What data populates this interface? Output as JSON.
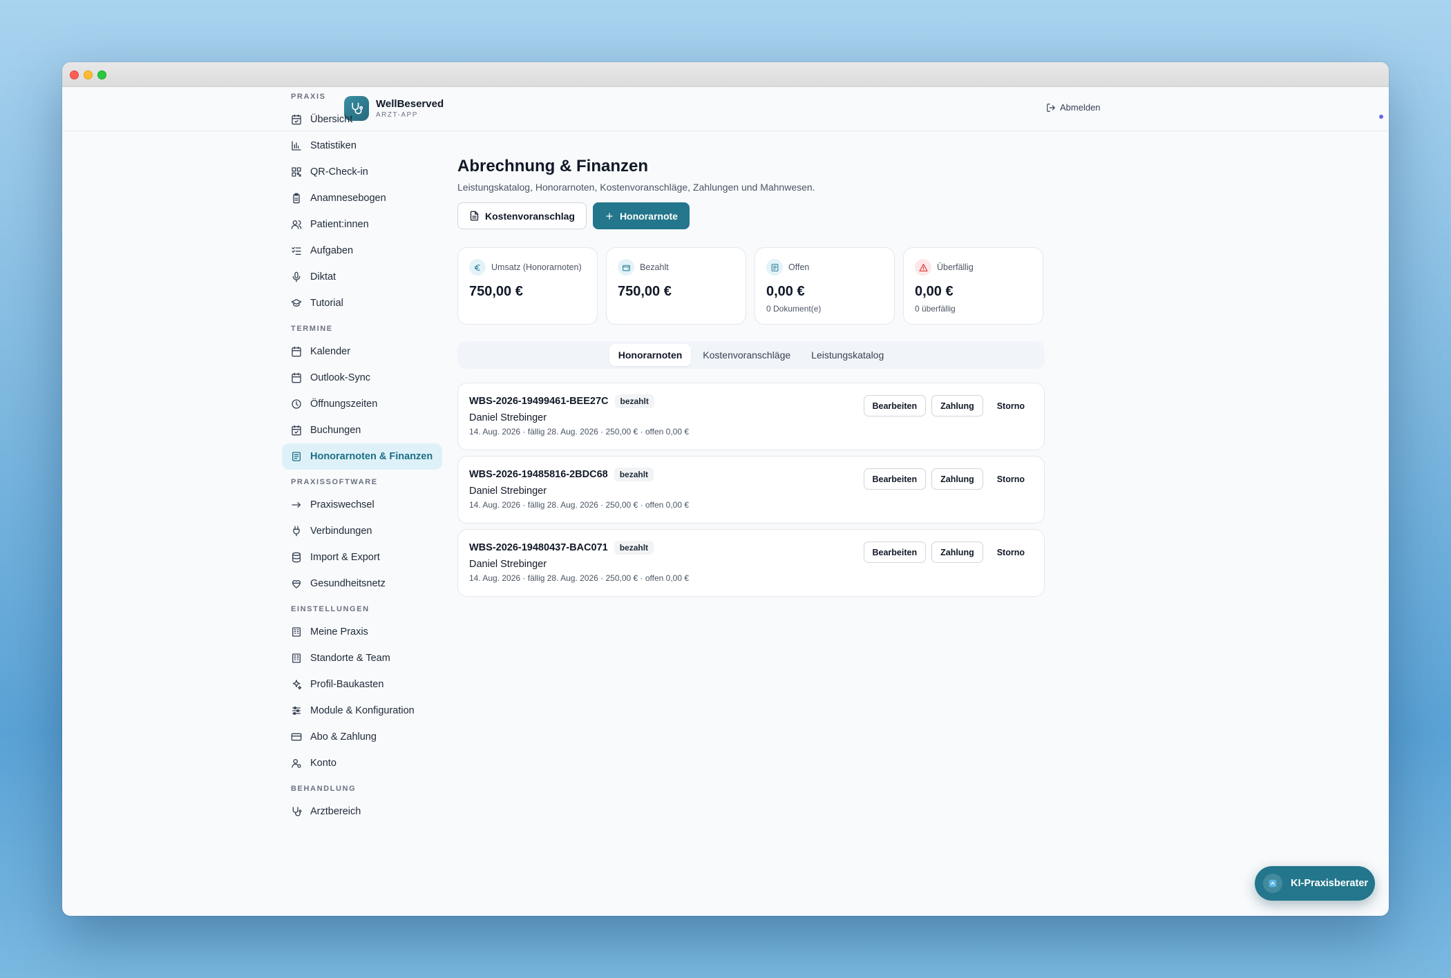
{
  "brand": {
    "name": "WellBeserved",
    "sub": "ARZT-APP"
  },
  "header": {
    "logout_label": "Abmelden"
  },
  "sidebar": {
    "sections": [
      {
        "label": "PRAXIS",
        "items": [
          {
            "label": "Übersicht",
            "icon": "calendar-check-icon"
          },
          {
            "label": "Statistiken",
            "icon": "bar-chart-icon"
          },
          {
            "label": "QR-Check-in",
            "icon": "qr-code-icon"
          },
          {
            "label": "Anamnesebogen",
            "icon": "clipboard-icon"
          },
          {
            "label": "Patient:innen",
            "icon": "users-icon"
          },
          {
            "label": "Aufgaben",
            "icon": "checklist-icon"
          },
          {
            "label": "Diktat",
            "icon": "microphone-icon"
          },
          {
            "label": "Tutorial",
            "icon": "graduation-cap-icon"
          }
        ]
      },
      {
        "label": "TERMINE",
        "items": [
          {
            "label": "Kalender",
            "icon": "calendar-icon"
          },
          {
            "label": "Outlook-Sync",
            "icon": "calendar-icon"
          },
          {
            "label": "Öffnungszeiten",
            "icon": "clock-icon"
          },
          {
            "label": "Buchungen",
            "icon": "calendar-check-icon"
          },
          {
            "label": "Honorarnoten & Finanzen",
            "icon": "receipt-icon",
            "active": true
          }
        ]
      },
      {
        "label": "PRAXISSOFTWARE",
        "items": [
          {
            "label": "Praxiswechsel",
            "icon": "arrow-right-icon"
          },
          {
            "label": "Verbindungen",
            "icon": "plug-icon"
          },
          {
            "label": "Import & Export",
            "icon": "database-icon"
          },
          {
            "label": "Gesundheitsnetz",
            "icon": "heart-network-icon"
          }
        ]
      },
      {
        "label": "EINSTELLUNGEN",
        "items": [
          {
            "label": "Meine Praxis",
            "icon": "building-icon"
          },
          {
            "label": "Standorte & Team",
            "icon": "building-icon"
          },
          {
            "label": "Profil-Baukasten",
            "icon": "sparkles-icon"
          },
          {
            "label": "Module & Konfiguration",
            "icon": "sliders-icon"
          },
          {
            "label": "Abo & Zahlung",
            "icon": "credit-card-icon"
          },
          {
            "label": "Konto",
            "icon": "user-gear-icon"
          }
        ]
      },
      {
        "label": "BEHANDLUNG",
        "items": [
          {
            "label": "Arztbereich",
            "icon": "stethoscope-icon"
          }
        ]
      }
    ]
  },
  "page": {
    "title": "Abrechnung & Finanzen",
    "subtitle": "Leistungskatalog, Honorarnoten, Kostenvoranschläge, Zahlungen und Mahnwesen.",
    "btn_quote": "Kostenvoranschlag",
    "btn_invoice": "Honorarnote"
  },
  "stats": [
    {
      "label": "Umsatz (Honorarnoten)",
      "value": "750,00 €",
      "note": "",
      "icon": "euro-icon",
      "color": "#2b7f95",
      "bg": "#e4f3f8"
    },
    {
      "label": "Bezahlt",
      "value": "750,00 €",
      "note": "",
      "icon": "wallet-icon",
      "color": "#2b7f95",
      "bg": "#e4f3f8"
    },
    {
      "label": "Offen",
      "value": "0,00 €",
      "note": "0 Dokument(e)",
      "icon": "receipt-icon",
      "color": "#2b7f95",
      "bg": "#e4f3f8"
    },
    {
      "label": "Überfällig",
      "value": "0,00 €",
      "note": "0 überfällig",
      "icon": "warning-icon",
      "color": "#dc2626",
      "bg": "#fde8e8"
    }
  ],
  "tabs": [
    {
      "label": "Honorarnoten",
      "active": true
    },
    {
      "label": "Kostenvoranschläge",
      "active": false
    },
    {
      "label": "Leistungskatalog",
      "active": false
    }
  ],
  "invoices": [
    {
      "number": "WBS-2026-19499461-BEE27C",
      "status": "bezahlt",
      "patient": "Daniel Strebinger",
      "meta": "14. Aug. 2026 · fällig 28. Aug. 2026 · 250,00 € · offen 0,00 €"
    },
    {
      "number": "WBS-2026-19485816-2BDC68",
      "status": "bezahlt",
      "patient": "Daniel Strebinger",
      "meta": "14. Aug. 2026 · fällig 28. Aug. 2026 · 250,00 € · offen 0,00 €"
    },
    {
      "number": "WBS-2026-19480437-BAC071",
      "status": "bezahlt",
      "patient": "Daniel Strebinger",
      "meta": "14. Aug. 2026 · fällig 28. Aug. 2026 · 250,00 € · offen 0,00 €"
    }
  ],
  "invoice_actions": {
    "edit": "Bearbeiten",
    "payment": "Zahlung",
    "cancel": "Storno"
  },
  "ai_button": {
    "label": "KI-Praxisberater"
  }
}
